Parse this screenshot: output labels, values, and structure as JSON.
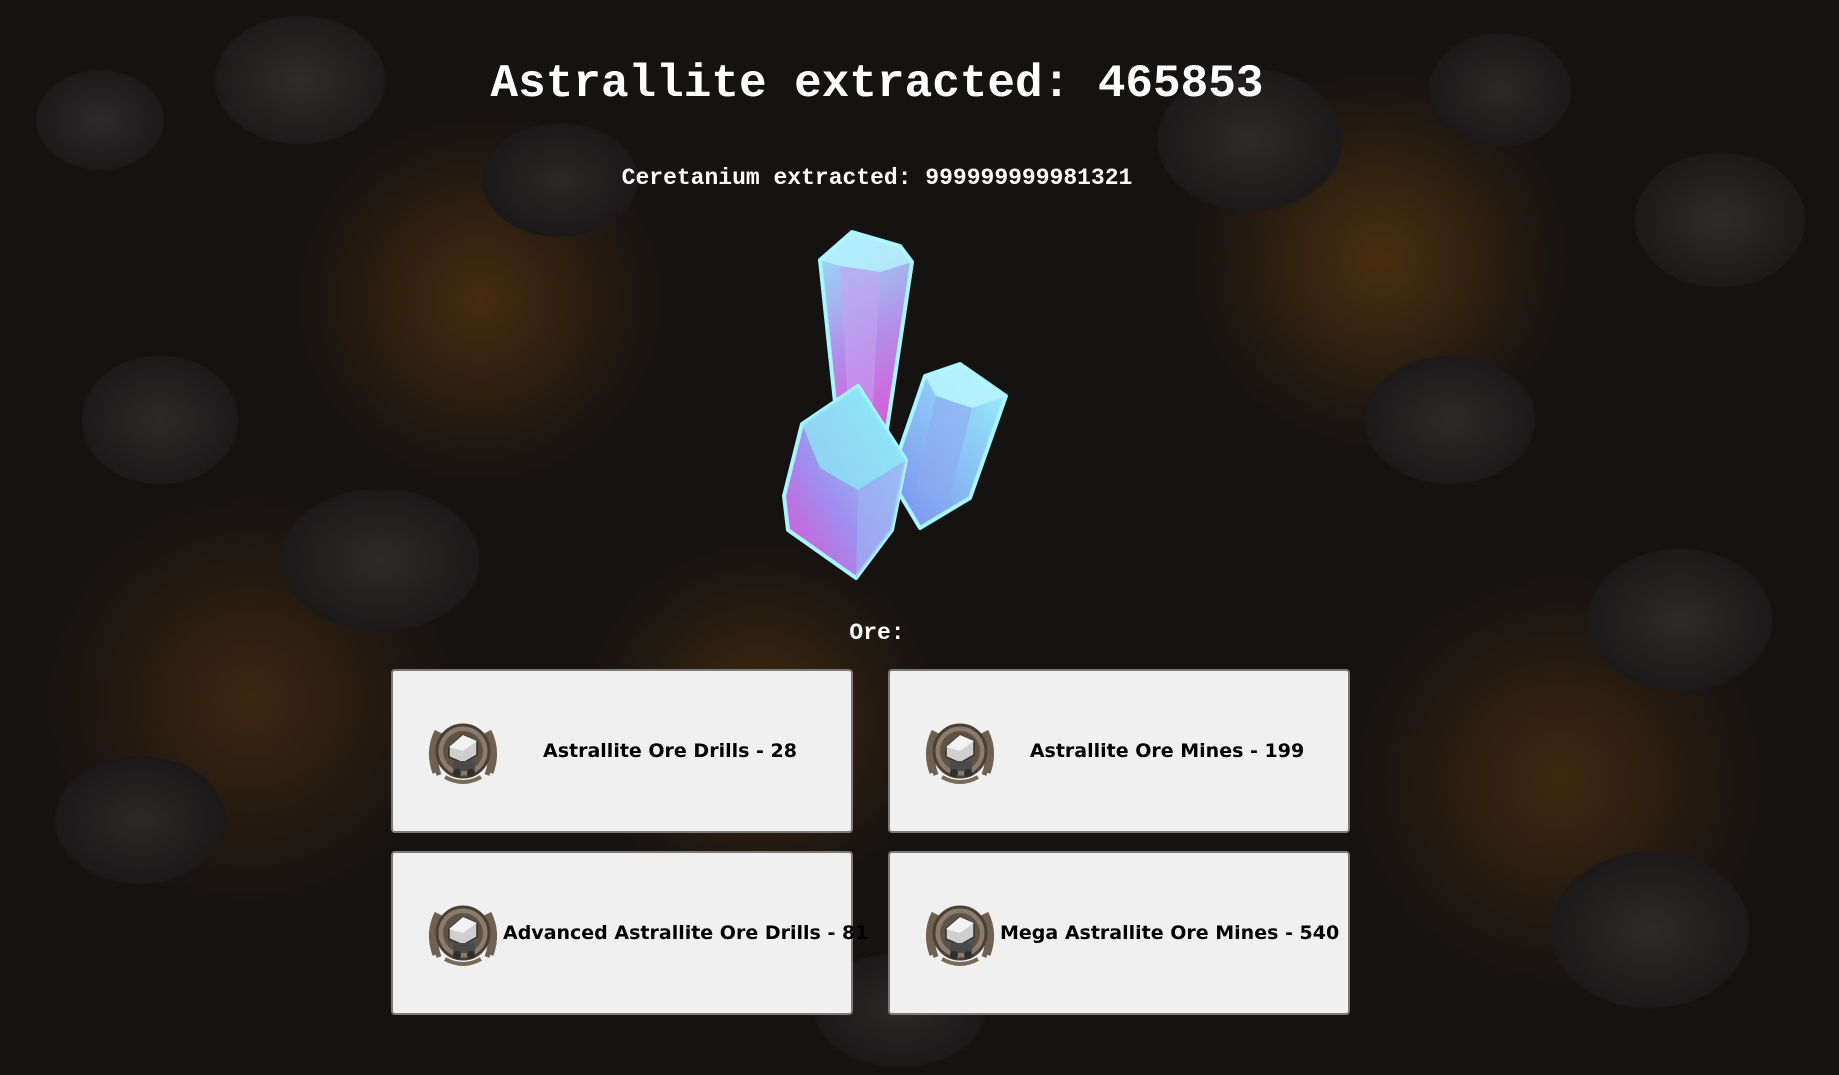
{
  "header": {
    "title": "Astrallite extracted: 465853",
    "subtitle": "Ceretanium extracted: 999999999981321"
  },
  "crystal": {
    "icon": "crystal-icon",
    "colors": [
      "#7ee8f8",
      "#e055d8",
      "#9a8ff0"
    ]
  },
  "ore_section": {
    "label": "Ore:",
    "items": [
      {
        "label": "Astrallite Ore Drills - 28",
        "icon": "drill-emblem-icon"
      },
      {
        "label": "Astrallite Ore Mines - 199",
        "icon": "mine-emblem-icon"
      },
      {
        "label": "Advanced Astrallite Ore Drills - 81",
        "icon": "drill-emblem-icon"
      },
      {
        "label": "Mega Astrallite Ore Mines - 540",
        "icon": "mine-emblem-icon"
      }
    ]
  }
}
